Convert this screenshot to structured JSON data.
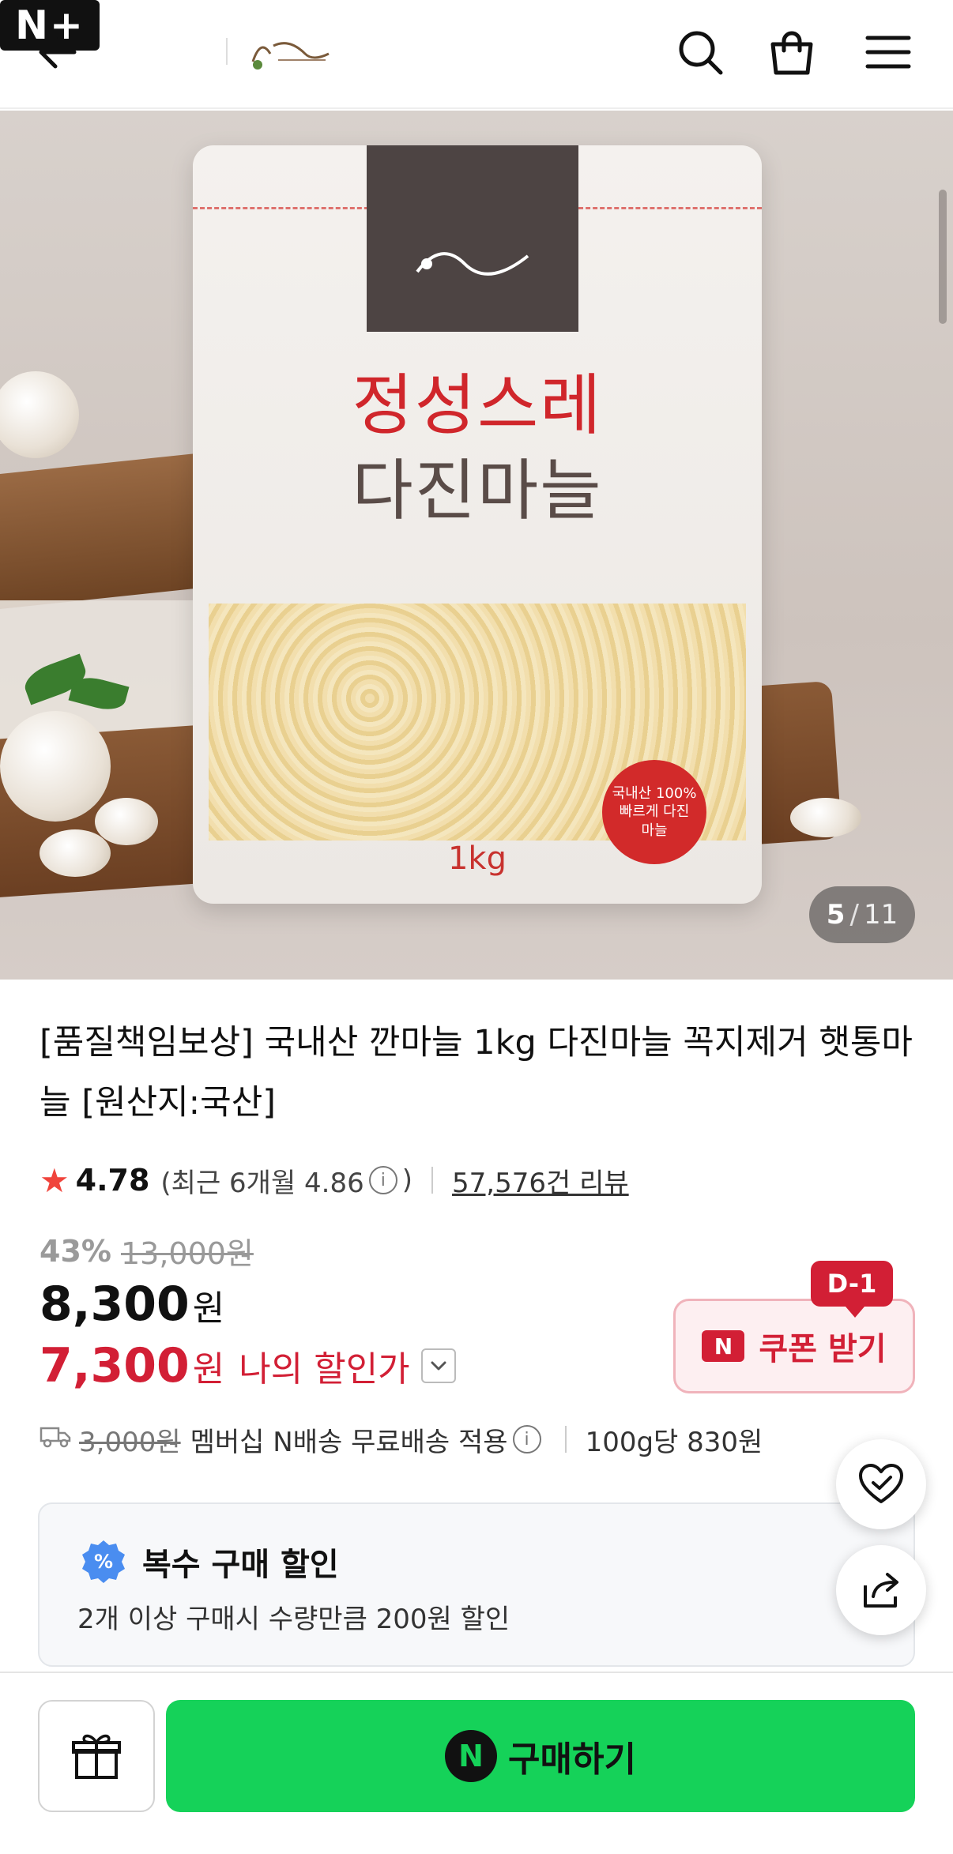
{
  "header": {
    "nplus_label": "N+",
    "icons": [
      "back-arrow-icon",
      "search-icon",
      "cart-icon",
      "menu-icon"
    ]
  },
  "hero": {
    "bag_title_line1": "정성스레",
    "bag_title_line2": "다진마늘",
    "bag_weight": "1kg",
    "seal_line1": "국내산 100%",
    "seal_line2": "빠르게 다진",
    "seal_line3": "마늘",
    "image_index": "5",
    "image_total": "11"
  },
  "product": {
    "title": "[품질책임보상] 국내산 깐마늘 1kg 다진마늘 꼭지제거 햇통마늘 [원산지:국산]",
    "rating": "4.78",
    "recent_rating_prefix": "(최근 6개월 4.86",
    "recent_rating_suffix": ")",
    "review_count": "57,576건 리뷰",
    "discount_pct": "43%",
    "original_price": "13,000원",
    "price": "8,300",
    "price_unit": "원",
    "my_price": "7,300",
    "my_price_unit": "원",
    "my_price_label": "나의 할인가"
  },
  "coupon": {
    "dday": "D-1",
    "n_badge": "N",
    "label": "쿠폰 받기"
  },
  "shipping": {
    "orig_fee": "3,000원",
    "text": "멤버십 N배송 무료배송 적용",
    "unit_price": "100g당 830원"
  },
  "multi_discount": {
    "badge": "%",
    "title": "복수 구매 할인",
    "desc": "2개 이상 구매시 수량만큼 200원 할인"
  },
  "bottom_bar": {
    "buy_badge": "N",
    "buy_label": "구매하기"
  },
  "colors": {
    "accent_red": "#d21f35",
    "buy_green": "#15d259",
    "star": "#f0443c"
  }
}
